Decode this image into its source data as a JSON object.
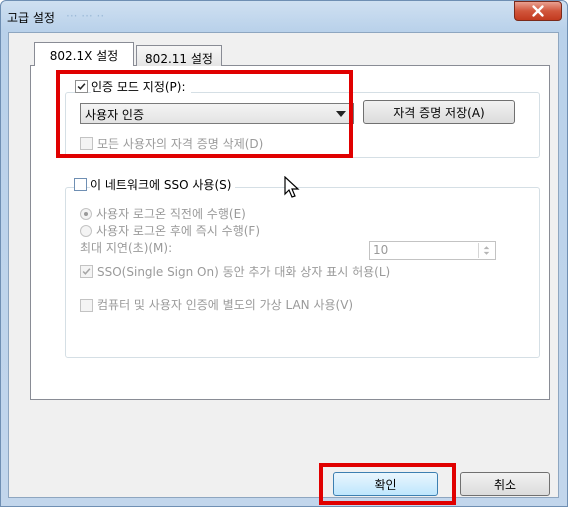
{
  "window": {
    "title": "고급 설정",
    "title_ghost": "··· ··· ··"
  },
  "tabs": [
    {
      "label": "802.1X 설정",
      "selected": true
    },
    {
      "label": "802.11 설정",
      "selected": false
    }
  ],
  "auth": {
    "checkbox_label": "인증 모드 지정(P):",
    "checked": true,
    "select_value": "사용자 인증",
    "save_cred_button": "자격 증명 저장(A)",
    "delete_cred_label": "모든 사용자의 자격 증명 삭제(D)",
    "delete_cred_checked": false
  },
  "sso": {
    "checkbox_label": "이 네트워크에 SSO 사용(S)",
    "checked": false,
    "radio_before": "사용자 로그온 직전에 수행(E)",
    "radio_after": "사용자 로그온 후에 즉시 수행(F)",
    "max_delay_label": "최대 지연(초)(M):",
    "max_delay_value": "10",
    "allow_dialog_label": "SSO(Single Sign On) 동안 추가 대화 상자 표시 허용(L)",
    "allow_dialog_checked": true,
    "vlan_label": "컴퓨터 및 사용자 인증에 별도의 가상 LAN 사용(V)",
    "vlan_checked": false
  },
  "buttons": {
    "ok": "확인",
    "cancel": "취소"
  },
  "colors": {
    "highlight": "#e00000",
    "close_button": "#c9432a"
  }
}
